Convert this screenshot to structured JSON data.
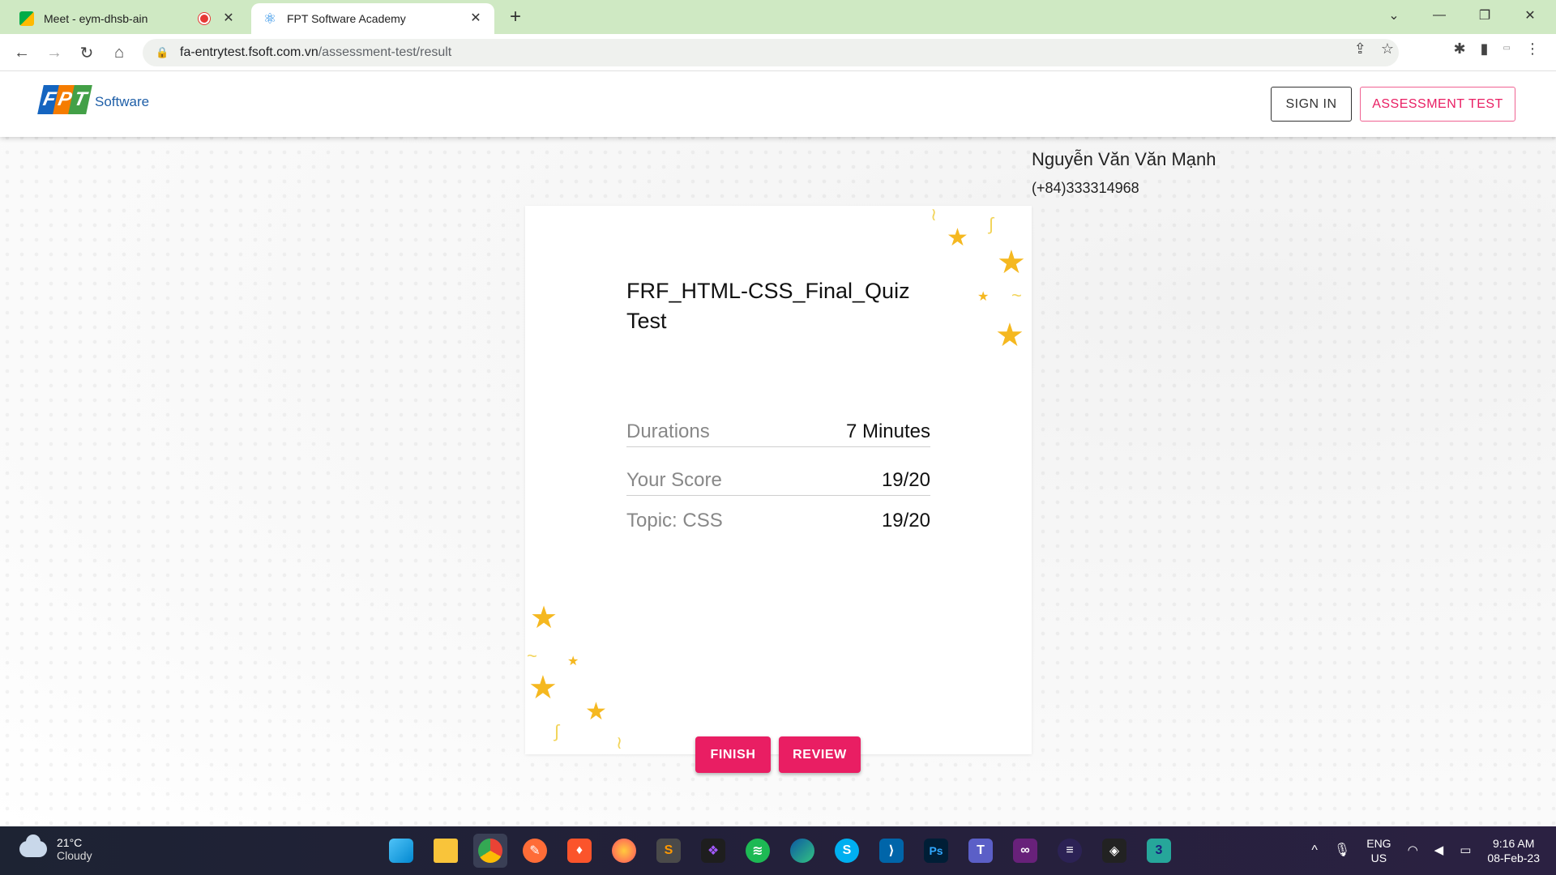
{
  "browser": {
    "tabs": [
      {
        "title": "Meet - eym-dhsb-ain",
        "active": false,
        "recording": true
      },
      {
        "title": "FPT Software Academy",
        "active": true,
        "recording": false
      }
    ],
    "url_host": "fa-entrytest.fsoft.com.vn",
    "url_path": "/assessment-test/result"
  },
  "header": {
    "logo_letters": [
      "F",
      "P",
      "T"
    ],
    "logo_text": "Software",
    "signin_label": "SIGN IN",
    "assessment_label": "ASSESSMENT TEST"
  },
  "user": {
    "name": "Nguyễn Văn Văn Mạnh",
    "phone": "(+84)333314968"
  },
  "result": {
    "title": "FRF_HTML-CSS_Final_Quiz Test",
    "rows": [
      {
        "label": "Durations",
        "value": "7 Minutes"
      },
      {
        "label": "Your Score",
        "value": "19/20"
      },
      {
        "label": "Topic: CSS",
        "value": "19/20"
      }
    ],
    "finish_label": "FINISH",
    "review_label": "REVIEW"
  },
  "taskbar": {
    "weather_temp": "21°C",
    "weather_desc": "Cloudy",
    "lang_top": "ENG",
    "lang_bottom": "US",
    "time": "9:16 AM",
    "date": "08-Feb-23"
  },
  "colors": {
    "accent": "#e91e63",
    "tabstrip": "#cfe9c3",
    "star": "#f5b820"
  }
}
